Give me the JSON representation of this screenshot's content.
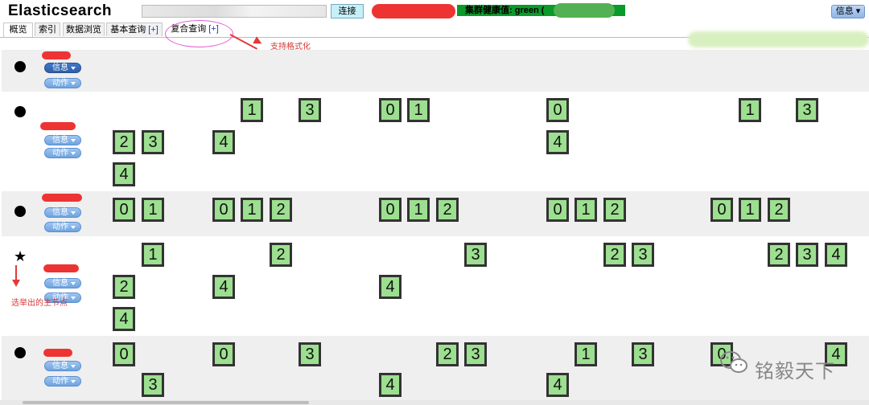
{
  "header": {
    "title": "Elasticsearch",
    "connect_label": "连接",
    "cluster_health": "集群健康值: green (",
    "cluster_health_suffix": ")",
    "info_label": "信息"
  },
  "tabs": [
    {
      "label": "概览",
      "plus": ""
    },
    {
      "label": "索引",
      "plus": ""
    },
    {
      "label": "数据浏览",
      "plus": ""
    },
    {
      "label": "基本查询",
      "plus": "[+]"
    },
    {
      "label": "复合查询",
      "plus": "[+]"
    }
  ],
  "annotations": {
    "format_support": "支持格式化",
    "master_node": "选举出的主节点"
  },
  "node_actions": {
    "info": "信息",
    "action": "动作"
  },
  "nodes": [
    {
      "marker": "dot",
      "shards": []
    },
    {
      "marker": "dot",
      "shards": [
        "1",
        "3",
        "0",
        "1",
        "0",
        "1",
        "3",
        "2",
        "3",
        "4",
        "4",
        "4"
      ]
    },
    {
      "marker": "dot",
      "shards": [
        "0",
        "1",
        "0",
        "1",
        "2",
        "0",
        "1",
        "2",
        "0",
        "1",
        "2",
        "0",
        "1",
        "2"
      ]
    },
    {
      "marker": "star",
      "shards": [
        "1",
        "2",
        "3",
        "2",
        "3",
        "2",
        "3",
        "4",
        "2",
        "4",
        "4",
        "4"
      ]
    },
    {
      "marker": "dot",
      "shards": [
        "0",
        "0",
        "3",
        "2",
        "3",
        "1",
        "3",
        "0",
        "4",
        "3",
        "4",
        "4"
      ]
    }
  ],
  "watermark": {
    "text": "铭毅天下",
    "icon": "wechat-icon"
  },
  "colors": {
    "health": "#0a9a2a",
    "shard_fill": "#9ddf90",
    "annotation": "#d63939",
    "action_pill": "#6ea3e0"
  }
}
